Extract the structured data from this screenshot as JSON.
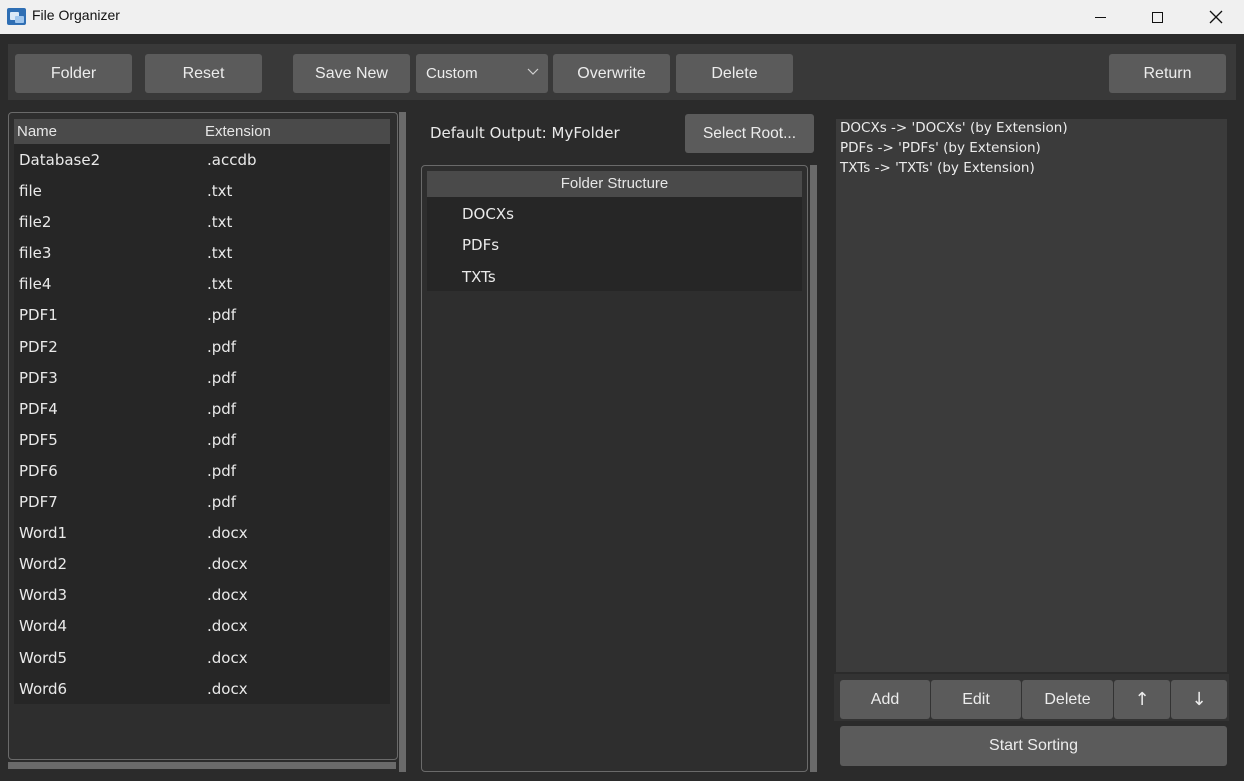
{
  "window": {
    "title": "File Organizer"
  },
  "toolbar": {
    "folder_label": "Folder",
    "reset_label": "Reset",
    "save_new_label": "Save New",
    "preset_value": "Custom",
    "overwrite_label": "Overwrite",
    "delete_label": "Delete",
    "return_label": "Return"
  },
  "files": {
    "headers": {
      "name": "Name",
      "extension": "Extension"
    },
    "rows": [
      {
        "name": "Database2",
        "ext": ".accdb"
      },
      {
        "name": "file",
        "ext": ".txt"
      },
      {
        "name": "file2",
        "ext": ".txt"
      },
      {
        "name": "file3",
        "ext": ".txt"
      },
      {
        "name": "file4",
        "ext": ".txt"
      },
      {
        "name": "PDF1",
        "ext": ".pdf"
      },
      {
        "name": "PDF2",
        "ext": ".pdf"
      },
      {
        "name": "PDF3",
        "ext": ".pdf"
      },
      {
        "name": "PDF4",
        "ext": ".pdf"
      },
      {
        "name": "PDF5",
        "ext": ".pdf"
      },
      {
        "name": "PDF6",
        "ext": ".pdf"
      },
      {
        "name": "PDF7",
        "ext": ".pdf"
      },
      {
        "name": "Word1",
        "ext": ".docx"
      },
      {
        "name": "Word2",
        "ext": ".docx"
      },
      {
        "name": "Word3",
        "ext": ".docx"
      },
      {
        "name": "Word4",
        "ext": ".docx"
      },
      {
        "name": "Word5",
        "ext": ".docx"
      },
      {
        "name": "Word6",
        "ext": ".docx"
      }
    ]
  },
  "output": {
    "default_label": "Default Output: MyFolder",
    "select_root_label": "Select Root..."
  },
  "folder_tree": {
    "header": "Folder Structure",
    "items": [
      "DOCXs",
      "PDFs",
      "TXTs"
    ]
  },
  "rules": {
    "items": [
      "DOCXs  ->  'DOCXs' (by Extension)",
      "PDFs  ->  'PDFs' (by Extension)",
      "TXTs  ->  'TXTs' (by Extension)"
    ],
    "add_label": "Add",
    "edit_label": "Edit",
    "delete_label": "Delete",
    "up_label": "↑",
    "down_label": "↓",
    "start_label": "Start Sorting"
  }
}
